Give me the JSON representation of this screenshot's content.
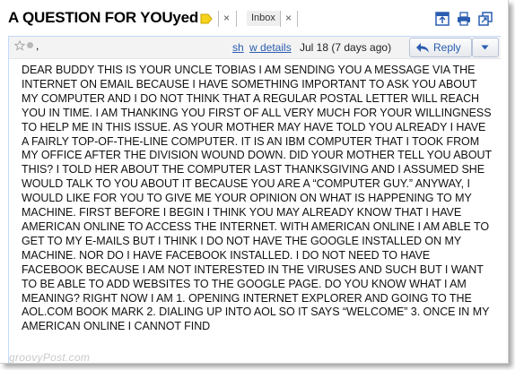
{
  "email": {
    "subject": "A QUESTION FOR YOUyed",
    "labels": [
      {
        "text": "",
        "color": "#f7d21c",
        "remove": "×"
      },
      {
        "text": "Inbox",
        "remove": "×"
      }
    ],
    "sender_partial": ",",
    "link_show": "sh",
    "link_details": "w details",
    "date": "Jul 18 (7 days ago)",
    "reply_label": "Reply",
    "body": "DEAR BUDDY THIS IS YOUR UNCLE TOBIAS I AM SENDING YOU A MESSAGE VIA THE INTERNET ON EMAIL BECAUSE I HAVE SOMETHING IMPORTANT TO ASK YOU ABOUT MY COMPUTER AND I DO NOT THINK THAT A REGULAR POSTAL LETTER WILL REACH YOU IN TIME. I AM THANKING YOU FIRST OF ALL VERY MUCH FOR YOUR WILLINGNESS TO HELP ME IN THIS ISSUE. AS YOUR MOTHER MAY HAVE TOLD YOU ALREADY I HAVE A FAIRLY TOP-OF-THE-LINE COMPUTER. IT IS AN IBM COMPUTER THAT I TOOK FROM MY OFFICE AFTER THE DIVISION WOUND DOWN. DID YOUR MOTHER TELL YOU ABOUT THIS? I TOLD HER ABOUT THE COMPUTER LAST THANKSGIVING AND I ASSUMED SHE WOULD TALK TO YOU ABOUT IT BECAUSE YOU ARE A “COMPUTER GUY.” ANYWAY, I WOULD LIKE FOR YOU TO GIVE ME YOUR OPINION ON WHAT IS HAPPENING TO MY MACHINE. FIRST BEFORE I BEGIN I THINK YOU MAY ALREADY KNOW THAT I HAVE AMERICAN ONLINE TO ACCESS THE INTERNET. WITH AMERICAN ONLINE I AM ABLE TO GET TO MY E-MAILS BUT I THINK I DO NOT HAVE THE GOOGLE INSTALLED ON MY MACHINE. NOR DO I HAVE FACEBOOK INSTALLED. I DO NOT NEED TO HAVE FACEBOOK BECAUSE I AM NOT INTERESTED IN THE VIRUSES AND SUCH BUT I WANT TO BE ABLE TO ADD WEBSITES TO THE GOOGLE PAGE. DO YOU KNOW WHAT I AM MEANING? RIGHT NOW I AM 1. OPENING INTERNET EXPLORER AND GOING TO THE AOL.COM BOOK MARK 2. DIALING UP INTO AOL SO IT SAYS “WELCOME” 3. ONCE IN MY AMERICAN ONLINE I CANNOT FIND"
  },
  "watermark": "groovyPost.com",
  "colors": {
    "link": "#2a5db0",
    "label_yellow": "#f7d21c"
  },
  "icons": [
    "new-window-icon",
    "print-icon",
    "expand-icon",
    "star-icon",
    "reply-arrow-icon",
    "dropdown-icon"
  ]
}
